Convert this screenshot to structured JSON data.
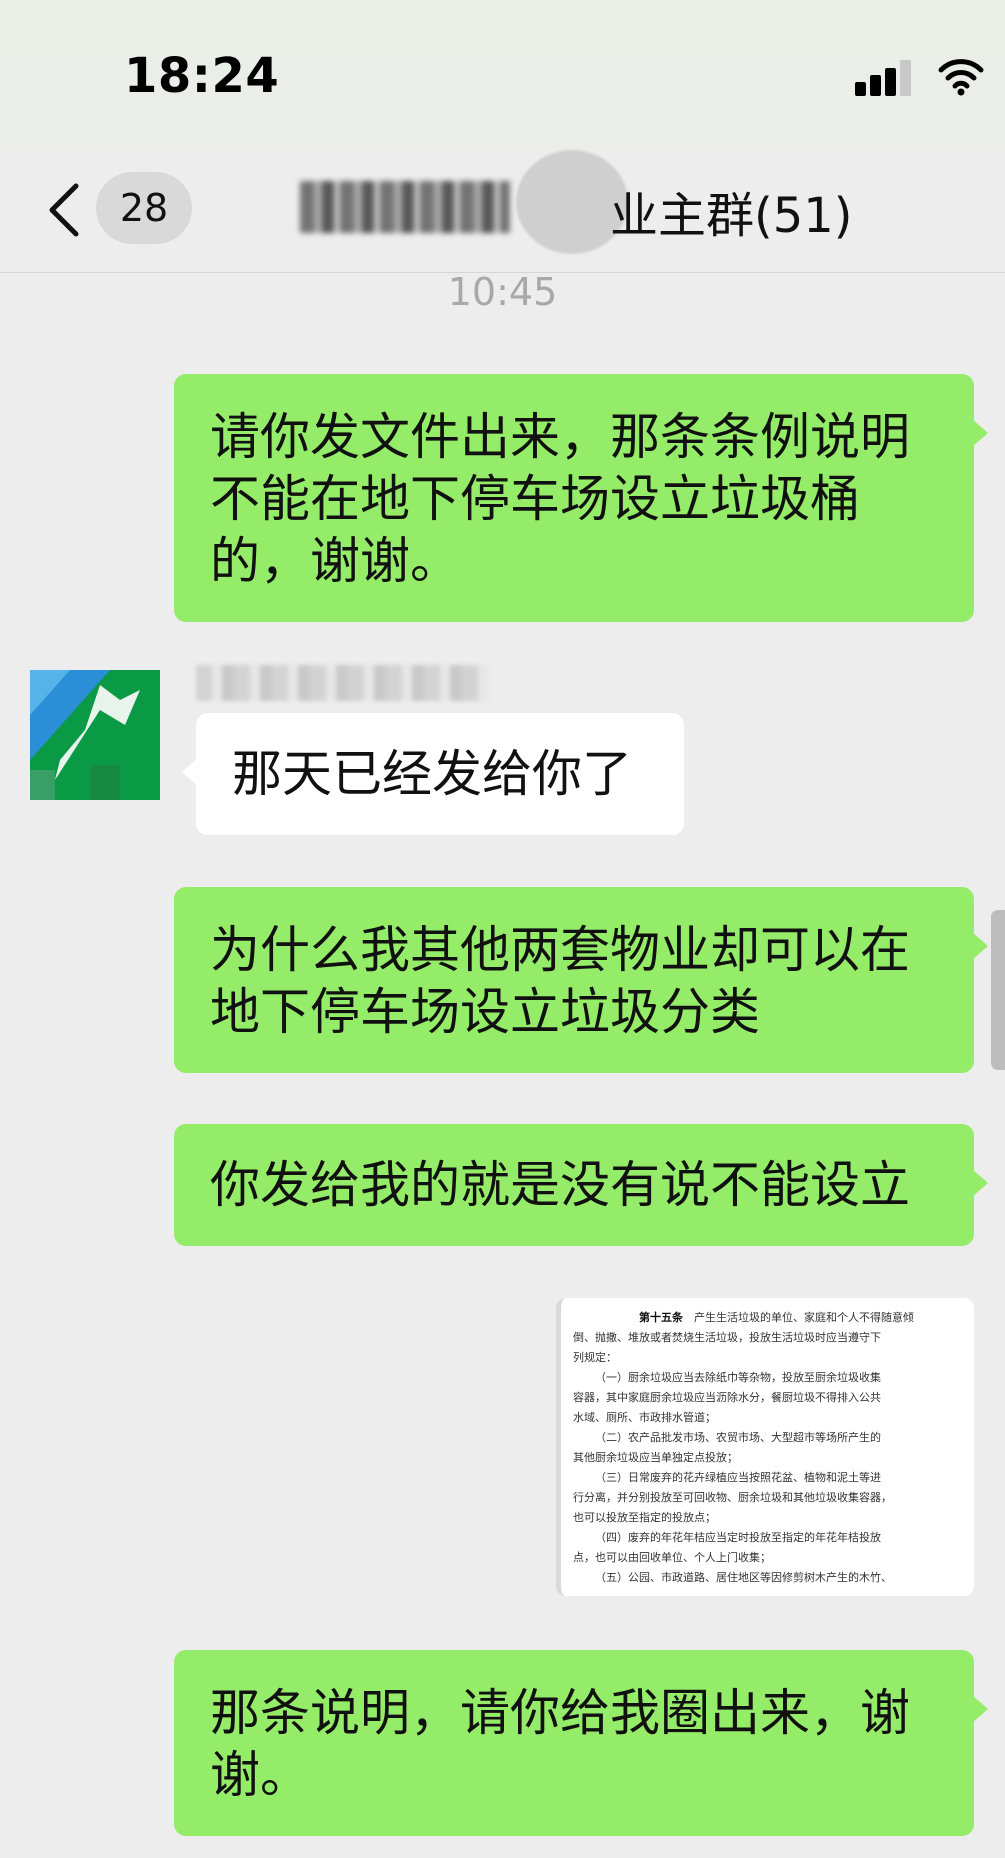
{
  "status_bar": {
    "time": "18:24"
  },
  "nav": {
    "unread_count": "28",
    "title_visible": "业主群(51)"
  },
  "chat": {
    "timestamp": "10:45",
    "messages": [
      {
        "from": "me",
        "text": "请你发文件出来，那条条例说明不能在地下停车场设立垃圾桶的，谢谢。"
      },
      {
        "from": "other",
        "text": "那天已经发给你了"
      },
      {
        "from": "me",
        "text": "为什么我其他两套物业却可以在地下停车场设立垃圾分类"
      },
      {
        "from": "me",
        "text": "你发给我的就是没有说不能设立"
      },
      {
        "from": "me",
        "text": "那条说明，请你给我圈出来，谢谢。"
      }
    ],
    "document": {
      "article": "第十五条",
      "lines": [
        "产生生活垃圾的单位、家庭和个人不得随意倾",
        "倒、抛撒、堆放或者焚烧生活垃圾，投放生活垃圾时应当遵守下",
        "列规定：",
        "（一）厨余垃圾应当去除纸巾等杂物，投放至厨余垃圾收集",
        "容器，其中家庭厨余垃圾应当沥除水分，餐厨垃圾不得排入公共",
        "水域、厕所、市政排水管道；",
        "（二）农产品批发市场、农贸市场、大型超市等场所产生的",
        "其他厨余垃圾应当单独定点投放；",
        "（三）日常废弃的花卉绿植应当按照花盆、植物和泥土等进",
        "行分离，并分别投放至可回收物、厨余垃圾和其他垃圾收集容器，",
        "也可以投放至指定的投放点；",
        "（四）废弃的年花年桔应当定时投放至指定的年花年桔投放",
        "点，也可以由回收单位、个人上门收集；",
        "（五）公园、市政道路、居住地区等因修剪树木产生的木竹、"
      ]
    }
  }
}
